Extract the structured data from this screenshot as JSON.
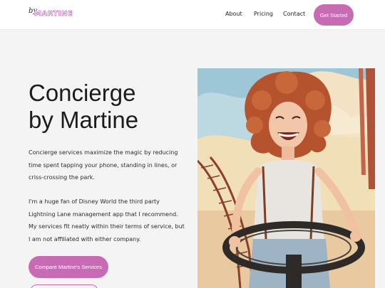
{
  "brand": {
    "prefix": "by",
    "name": "MARTINE"
  },
  "nav": {
    "links": [
      "About",
      "Pricing",
      "Contact"
    ],
    "cta_label": "Get Started"
  },
  "hero": {
    "title_line1": "Concierge",
    "title_line2": "by Martine",
    "paragraph1": "Concierge services maximize the magic by reducing time spent tapping your phone, standing in lines, or criss-crossing the park.",
    "paragraph2": "I'm a huge fan of Disney World the third party Lightning Lane management app that I recommend. My services fit neatly within their terms of service, but I am not affiliated with either company.",
    "primary_button": "Compare Martine's Services"
  },
  "colors": {
    "accent": "#c86bb5",
    "background": "#f4f4f4",
    "text": "#1c1c1c"
  }
}
